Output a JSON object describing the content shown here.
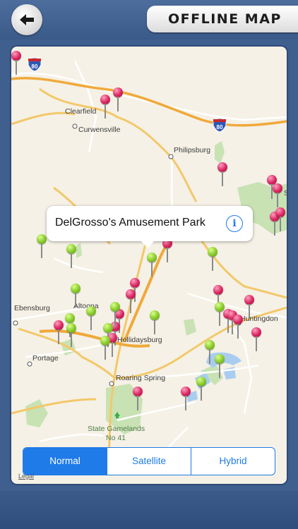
{
  "header": {
    "back_icon": "arrow-left-icon",
    "title": "OFFLINE MAP"
  },
  "map": {
    "labels": {
      "clearfield": "Clearfield",
      "curwensville": "Curwensville",
      "philipsburg": "Philipsburg",
      "ebensburg": "Ebensburg",
      "altoona": "Altoona",
      "hollidaysburg": "Hollidaysburg",
      "huntingdon": "Huntingdon",
      "portage": "Portage",
      "roaring_spring": "Roaring Spring",
      "state_gamelands": "State Gamelands",
      "no41": "No 41",
      "s_partial": "S",
      "hwy_80_a": "80",
      "hwy_80_b": "80"
    },
    "legal": "Legal",
    "callout": {
      "title": "DelGrosso's Amusement Park",
      "info_icon": "info-icon"
    },
    "pin_colors": {
      "red": "#d8245f",
      "green": "#86c82a"
    }
  },
  "map_type": {
    "options": [
      "Normal",
      "Satellite",
      "Hybrid"
    ],
    "selected": "Normal"
  },
  "colors": {
    "accent": "#1e7be8",
    "chrome": "#3f5f8f"
  }
}
